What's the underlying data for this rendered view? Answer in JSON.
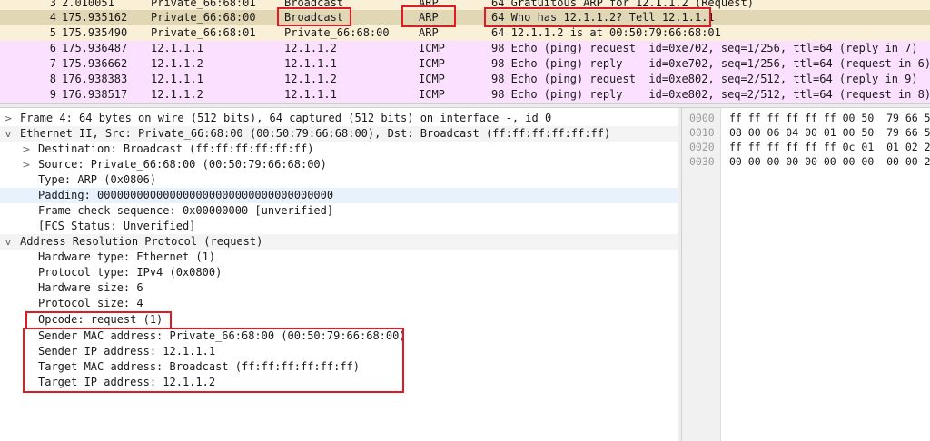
{
  "packets": [
    {
      "no": "3",
      "time": "2.010051",
      "source": "Private_66:68:01",
      "destination": "Broadcast",
      "protocol": "ARP",
      "info": "64 Gratuitous ARP for 12.1.1.2 (Request)"
    },
    {
      "no": "4",
      "time": "175.935162",
      "source": "Private_66:68:00",
      "destination": "Broadcast",
      "protocol": "ARP",
      "info": "64 Who has 12.1.1.2? Tell 12.1.1.1"
    },
    {
      "no": "5",
      "time": "175.935490",
      "source": "Private_66:68:01",
      "destination": "Private_66:68:00",
      "protocol": "ARP",
      "info": "64 12.1.1.2 is at 00:50:79:66:68:01"
    },
    {
      "no": "6",
      "time": "175.936487",
      "source": "12.1.1.1",
      "destination": "12.1.1.2",
      "protocol": "ICMP",
      "info": "98 Echo (ping) request  id=0xe702, seq=1/256, ttl=64 (reply in 7)"
    },
    {
      "no": "7",
      "time": "175.936662",
      "source": "12.1.1.2",
      "destination": "12.1.1.1",
      "protocol": "ICMP",
      "info": "98 Echo (ping) reply    id=0xe702, seq=1/256, ttl=64 (request in 6)"
    },
    {
      "no": "8",
      "time": "176.938383",
      "source": "12.1.1.1",
      "destination": "12.1.1.2",
      "protocol": "ICMP",
      "info": "98 Echo (ping) request  id=0xe802, seq=2/512, ttl=64 (reply in 9)"
    },
    {
      "no": "9",
      "time": "176.938517",
      "source": "12.1.1.2",
      "destination": "12.1.1.1",
      "protocol": "ICMP",
      "info": "98 Echo (ping) reply    id=0xe802, seq=2/512, ttl=64 (request in 8)"
    }
  ],
  "details": [
    {
      "text": "Frame 4: 64 bytes on wire (512 bits), 64 captured (512 bits) on interface -, id 0",
      "arrow": ">"
    },
    {
      "text": "Ethernet II, Src: Private_66:68:00 (00:50:79:66:68:00), Dst: Broadcast (ff:ff:ff:ff:ff:ff)",
      "arrow": "v"
    },
    {
      "text": "Destination: Broadcast (ff:ff:ff:ff:ff:ff)",
      "arrow": ">"
    },
    {
      "text": "Source: Private_66:68:00 (00:50:79:66:68:00)",
      "arrow": ">"
    },
    {
      "text": "Type: ARP (0x0806)",
      "arrow": ""
    },
    {
      "text": "Padding: 000000000000000000000000000000000000",
      "arrow": ""
    },
    {
      "text": "Frame check sequence: 0x00000000 [unverified]",
      "arrow": ""
    },
    {
      "text": "[FCS Status: Unverified]",
      "arrow": ""
    },
    {
      "text": "Address Resolution Protocol (request)",
      "arrow": "v"
    },
    {
      "text": "Hardware type: Ethernet (1)",
      "arrow": ""
    },
    {
      "text": "Protocol type: IPv4 (0x0800)",
      "arrow": ""
    },
    {
      "text": "Hardware size: 6",
      "arrow": ""
    },
    {
      "text": "Protocol size: 4",
      "arrow": ""
    },
    {
      "text": "Opcode: request (1)",
      "arrow": ""
    },
    {
      "text": "Sender MAC address: Private_66:68:00 (00:50:79:66:68:00)",
      "arrow": ""
    },
    {
      "text": "Sender IP address: 12.1.1.1",
      "arrow": ""
    },
    {
      "text": "Target MAC address: Broadcast (ff:ff:ff:ff:ff:ff)",
      "arrow": ""
    },
    {
      "text": "Target IP address: 12.1.1.2",
      "arrow": ""
    }
  ],
  "hex": [
    {
      "offset": "0000",
      "bytes": "ff ff ff ff ff ff 00 50  79 66 5"
    },
    {
      "offset": "0010",
      "bytes": "08 00 06 04 00 01 00 50  79 66 5"
    },
    {
      "offset": "0020",
      "bytes": "ff ff ff ff ff ff 0c 01  01 02 2"
    },
    {
      "offset": "0030",
      "bytes": "00 00 00 00 00 00 00 00  00 00 2"
    }
  ],
  "colors": {
    "arp_row": "#faf0d7",
    "icmp_row": "#fce0ff",
    "selected_row": "#e2d7b4",
    "annotation": "#e01b24"
  },
  "icons": {
    "collapsed": "chevron-right-icon",
    "expanded": "chevron-down-icon"
  }
}
